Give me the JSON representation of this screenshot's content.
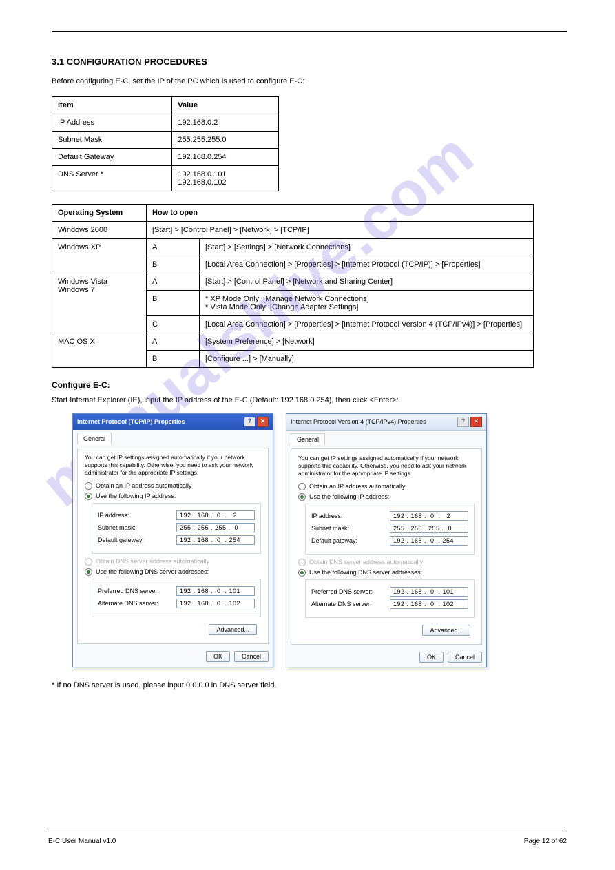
{
  "watermark_text": "manualshive.com",
  "section": {
    "title": "3.1  CONFIGURATION PROCEDURES",
    "intro": "Before configuring E-C, set the IP of the PC which is used to configure E-C:",
    "subsection_title": "Configure E-C:",
    "para1": "Start Internet Explorer (IE), input the IP address of the E-C (Default: 192.168.0.254), then click <Enter>:",
    "footnote1": "* If no DNS server is used, please input 0.0.0.0 in DNS server field."
  },
  "table1": {
    "headers": [
      "Item",
      "Value"
    ],
    "rows": [
      [
        "IP Address",
        "192.168.0.2"
      ],
      [
        "Subnet Mask",
        "255.255.255.0"
      ],
      [
        "Default Gateway",
        "192.168.0.254"
      ],
      [
        "DNS Server *",
        "192.168.0.101\n192.168.0.102"
      ]
    ]
  },
  "table2": {
    "headers": [
      "Operating System",
      "How to open",
      ""
    ],
    "rows": [
      {
        "os": "Windows 2000",
        "step": "",
        "text": "[Start] > [Control Panel] > [Network] > [TCP/IP]"
      },
      {
        "os_row": "Windows XP",
        "step": "A",
        "text": "[Start] > [Settings] > [Network Connections]"
      },
      {
        "step": "B",
        "text": "[Local Area Connection] > [Properties] > [Internet Protocol (TCP/IP)] > [Properties]"
      },
      {
        "os_row": "Windows Vista\nWindows 7",
        "step": "A",
        "text": "[Start] > [Control Panel] > [Network and Sharing Center]"
      },
      {
        "step": "B",
        "text": "* XP Mode Only: [Manage Network Connections]\n* Vista Mode Only: [Change Adapter Settings]"
      },
      {
        "step": "C",
        "text": "[Local Area Connection] > [Properties] > [Internet Protocol Version 4 (TCP/IPv4)] > [Properties]"
      },
      {
        "os_row": "MAC OS X",
        "step": "A",
        "text": "[System Preference] > [Network]"
      },
      {
        "step": "B",
        "text": "[Configure ...] > [Manually]"
      }
    ]
  },
  "dialog_xp": {
    "title": "Internet Protocol (TCP/IP) Properties",
    "tab": "General",
    "msg": "You can get IP settings assigned automatically if your network supports this capability. Otherwise, you need to ask your network administrator for the appropriate IP settings.",
    "radio_obtain_ip": "Obtain an IP address automatically",
    "radio_use_ip": "Use the following IP address:",
    "ip_label": "IP address:",
    "ip_value": "192 . 168 .  0  .   2",
    "mask_label": "Subnet mask:",
    "mask_value": "255 . 255 . 255 .  0",
    "gw_label": "Default gateway:",
    "gw_value": "192 . 168 .  0  . 254",
    "radio_obtain_dns": "Obtain DNS server address automatically",
    "radio_use_dns": "Use the following DNS server addresses:",
    "pdns_label": "Preferred DNS server:",
    "pdns_value": "192 . 168 .  0  . 101",
    "adns_label": "Alternate DNS server:",
    "adns_value": "192 . 168 .  0  . 102",
    "btn_adv": "Advanced...",
    "btn_ok": "OK",
    "btn_cancel": "Cancel"
  },
  "dialog_vista": {
    "title": "Internet Protocol Version 4 (TCP/IPv4) Properties",
    "tab": "General",
    "msg": "You can get IP settings assigned automatically if your network supports this capability. Otherwise, you need to ask your network administrator for the appropriate IP settings.",
    "radio_obtain_ip": "Obtain an IP address automatically",
    "radio_use_ip": "Use the following IP address:",
    "ip_label": "IP address:",
    "ip_value": "192 . 168 .  0  .   2",
    "mask_label": "Subnet mask:",
    "mask_value": "255 . 255 . 255 .  0",
    "gw_label": "Default gateway:",
    "gw_value": "192 . 168 .  0  . 254",
    "radio_obtain_dns": "Obtain DNS server address automatically",
    "radio_use_dns": "Use the following DNS server addresses:",
    "pdns_label": "Preferred DNS server:",
    "pdns_value": "192 . 168 .  0  . 101",
    "adns_label": "Alternate DNS server:",
    "adns_value": "192 . 168 .  0  . 102",
    "btn_adv": "Advanced...",
    "btn_ok": "OK",
    "btn_cancel": "Cancel"
  },
  "footer": {
    "left_text": "E-C User Manual v1.0",
    "right_text": "Page 12 of 62"
  }
}
